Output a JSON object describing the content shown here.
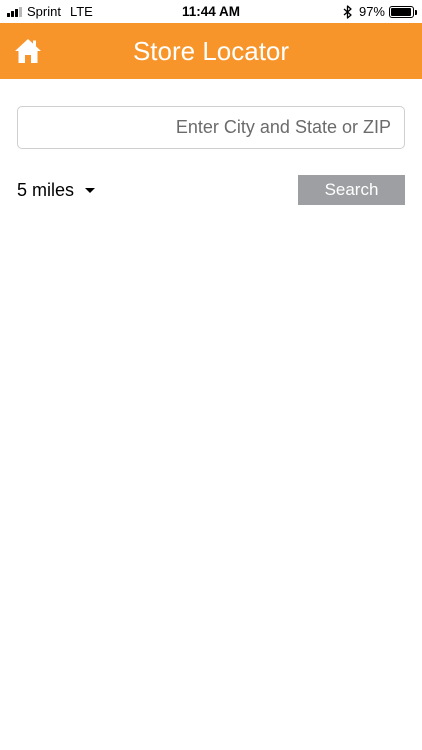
{
  "status_bar": {
    "carrier": "Sprint",
    "network": "LTE",
    "time": "11:44 AM",
    "battery_percent": "97%",
    "battery_level": 0.97,
    "signal_bars_active": 3,
    "signal_bars_total": 5
  },
  "navbar": {
    "title": "Store Locator",
    "home_icon": "home-icon",
    "color": "#f7952a"
  },
  "search": {
    "placeholder": "Enter City and State or ZIP",
    "value": ""
  },
  "radius": {
    "selected": "5 miles"
  },
  "search_button": {
    "label": "Search",
    "color": "#9d9fa2"
  }
}
